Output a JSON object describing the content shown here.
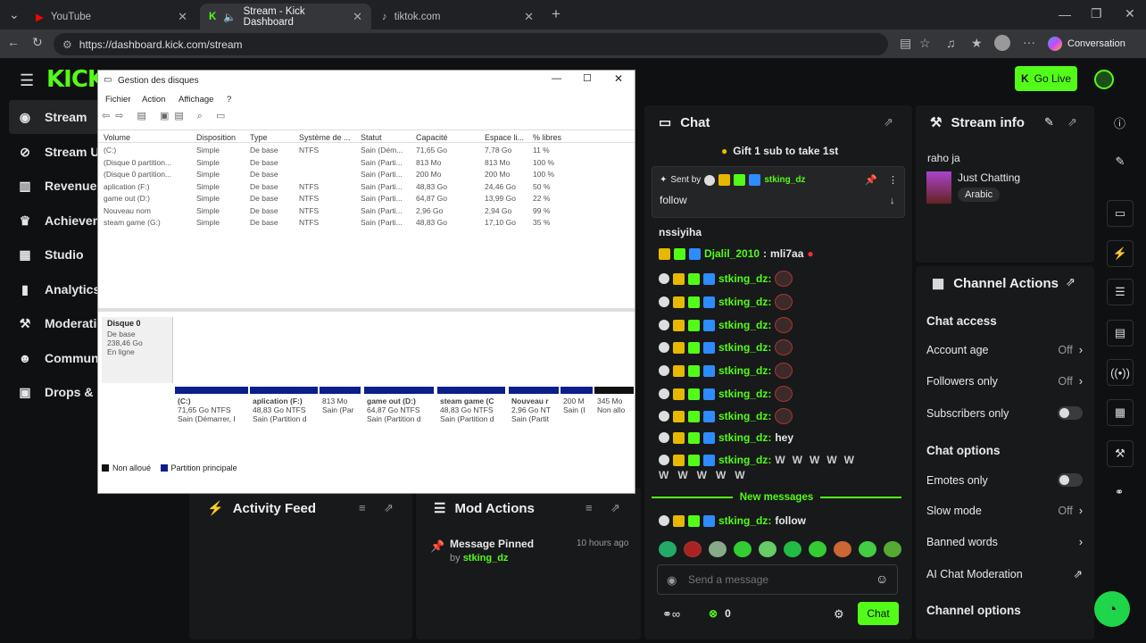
{
  "browser": {
    "tabs": [
      {
        "label": "YouTube"
      },
      {
        "label": "Stream - Kick Dashboard"
      },
      {
        "label": "tiktok.com"
      }
    ],
    "url": "https://dashboard.kick.com/stream",
    "conversation": "Conversation"
  },
  "kick": {
    "logo": "KICK",
    "go_live": "Go Live",
    "nav": [
      {
        "label": "Stream"
      },
      {
        "label": "Stream UI"
      },
      {
        "label": "Revenue"
      },
      {
        "label": "Achievem"
      },
      {
        "label": "Studio"
      },
      {
        "label": "Analytics"
      },
      {
        "label": "Moderatio"
      },
      {
        "label": "Communit"
      },
      {
        "label": "Drops & re"
      }
    ],
    "chat": {
      "title": "Chat",
      "gift": "Gift 1 sub to take 1st",
      "pinned": {
        "sent_by": "Sent by",
        "user": "stking_dz",
        "message": "follow"
      },
      "lines": [
        {
          "text": "nssiyiha"
        },
        {
          "user": "Djalil_2010",
          "msg": "mli7aa"
        },
        {
          "user": "stking_dz:"
        },
        {
          "user": "stking_dz:"
        },
        {
          "user": "stking_dz:"
        },
        {
          "user": "stking_dz:"
        },
        {
          "user": "stking_dz:"
        },
        {
          "user": "stking_dz:"
        },
        {
          "user": "stking_dz:"
        },
        {
          "user": "stking_dz:",
          "msg": "hey"
        },
        {
          "user": "stking_dz:"
        }
      ],
      "new_messages": "New messages",
      "last": {
        "user": "stking_dz:",
        "msg": "follow"
      },
      "placeholder": "Send a message",
      "count": "0",
      "chat_button": "Chat"
    },
    "stream_info": {
      "title": "Stream info",
      "stream_title": "raho ja",
      "category": "Just Chatting",
      "tag": "Arabic"
    },
    "channel_actions": {
      "title": "Channel Actions",
      "chat_access": "Chat access",
      "rows": [
        {
          "label": "Account age",
          "value": "Off"
        },
        {
          "label": "Followers only",
          "value": "Off"
        },
        {
          "label": "Subscribers only"
        }
      ],
      "chat_options": "Chat options",
      "rows2": [
        {
          "label": "Emotes only"
        },
        {
          "label": "Slow mode",
          "value": "Off"
        },
        {
          "label": "Banned words"
        },
        {
          "label": "AI Chat Moderation"
        }
      ],
      "channel_options": "Channel options"
    },
    "activity": {
      "title": "Activity Feed"
    },
    "mod": {
      "title": "Mod Actions",
      "item": "Message Pinned",
      "by": "by",
      "by_user": "stking_dz",
      "time": "10 hours ago"
    }
  },
  "disk": {
    "title": "Gestion des disques",
    "menu": [
      "Fichier",
      "Action",
      "Affichage",
      "?"
    ],
    "columns": [
      "Volume",
      "Disposition",
      "Type",
      "Système de ...",
      "Statut",
      "Capacité",
      "Espace li...",
      "% libres"
    ],
    "rows": [
      [
        "(C:)",
        "Simple",
        "De base",
        "NTFS",
        "Sain (Dém...",
        "71,65 Go",
        "7,78 Go",
        "11 %"
      ],
      [
        "(Disque 0 partition...",
        "Simple",
        "De base",
        "",
        "Sain (Parti...",
        "813 Mo",
        "813 Mo",
        "100 %"
      ],
      [
        "(Disque 0 partition...",
        "Simple",
        "De base",
        "",
        "Sain (Parti...",
        "200 Mo",
        "200 Mo",
        "100 %"
      ],
      [
        "aplication (F:)",
        "Simple",
        "De base",
        "NTFS",
        "Sain (Parti...",
        "48,83 Go",
        "24,46 Go",
        "50 %"
      ],
      [
        "game out (D:)",
        "Simple",
        "De base",
        "NTFS",
        "Sain (Parti...",
        "64,87 Go",
        "13,99 Go",
        "22 %"
      ],
      [
        "Nouveau nom",
        "Simple",
        "De base",
        "NTFS",
        "Sain (Parti...",
        "2,96 Go",
        "2,94 Go",
        "99 %"
      ],
      [
        "steam game (G:)",
        "Simple",
        "De base",
        "NTFS",
        "Sain (Parti...",
        "48,83 Go",
        "17,10 Go",
        "35 %"
      ]
    ],
    "disk0": {
      "name": "Disque 0",
      "type": "De base",
      "size": "238,46 Go",
      "status": "En ligne"
    },
    "parts": [
      {
        "name": "(C:)",
        "size": "71,65 Go NTFS",
        "status": "Sain (Démarrer, I"
      },
      {
        "name": "aplication (F:)",
        "size": "48,83 Go NTFS",
        "status": "Sain (Partition d"
      },
      {
        "name": "",
        "size": "813 Mo",
        "status": "Sain (Par"
      },
      {
        "name": "game out (D:)",
        "size": "64,87 Go NTFS",
        "status": "Sain (Partition d"
      },
      {
        "name": "steam game (C",
        "size": "48,83 Go NTFS",
        "status": "Sain (Partition d"
      },
      {
        "name": "Nouveau r",
        "size": "2,96 Go NT",
        "status": "Sain (Partit"
      },
      {
        "name": "",
        "size": "200 M",
        "status": "Sain (I"
      },
      {
        "name": "",
        "size": "345 Mo",
        "status": "Non allo"
      }
    ],
    "legend": [
      "Non alloué",
      "Partition principale"
    ]
  }
}
